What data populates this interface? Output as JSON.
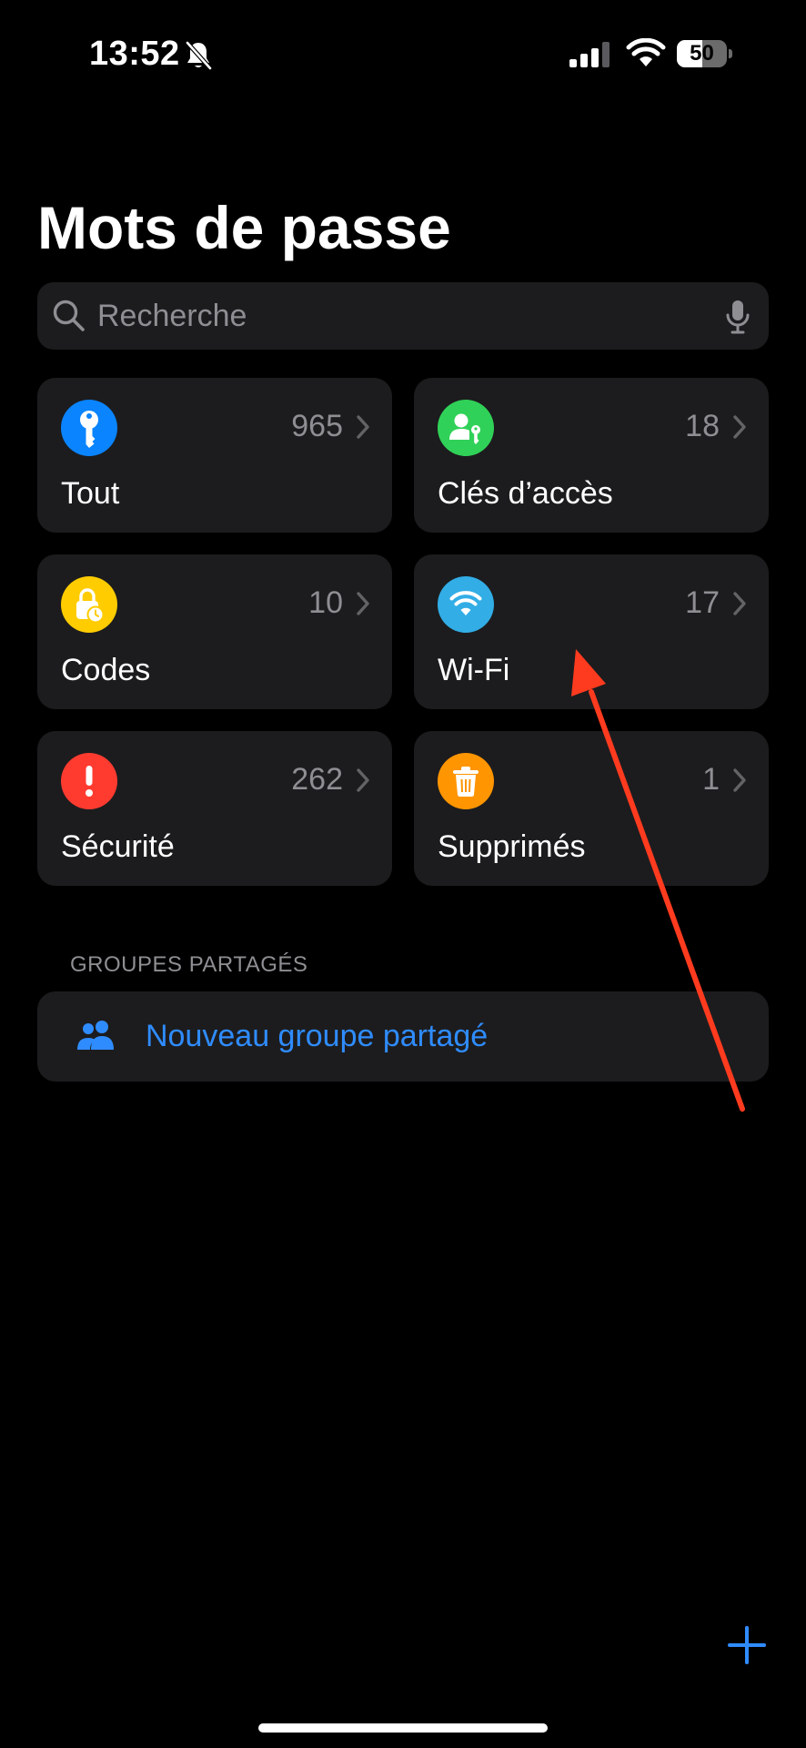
{
  "status_bar": {
    "time": "13:52",
    "battery_level": "50",
    "battery_fraction": 0.5
  },
  "title": "Mots de passe",
  "search": {
    "placeholder": "Recherche"
  },
  "tiles": [
    {
      "label": "Tout",
      "count": "965",
      "icon": "key-icon",
      "color": "#0a84ff"
    },
    {
      "label": "Clés d’accès",
      "count": "18",
      "icon": "passkey-person-icon",
      "color": "#30d158"
    },
    {
      "label": "Codes",
      "count": "10",
      "icon": "lock-clock-icon",
      "color": "#ffcc00"
    },
    {
      "label": "Wi-Fi",
      "count": "17",
      "icon": "wifi-icon",
      "color": "#32ade6"
    },
    {
      "label": "Sécurité",
      "count": "262",
      "icon": "exclamation-icon",
      "color": "#ff3b30"
    },
    {
      "label": "Supprimés",
      "count": "1",
      "icon": "trash-icon",
      "color": "#ff9500"
    }
  ],
  "shared_groups": {
    "header": "GROUPES PARTAGÉS",
    "new_group_label": "Nouveau groupe partagé"
  },
  "colors": {
    "accent": "#2f8cff",
    "tile_background": "#1c1c1e",
    "annotation": "#ff3b1f"
  }
}
